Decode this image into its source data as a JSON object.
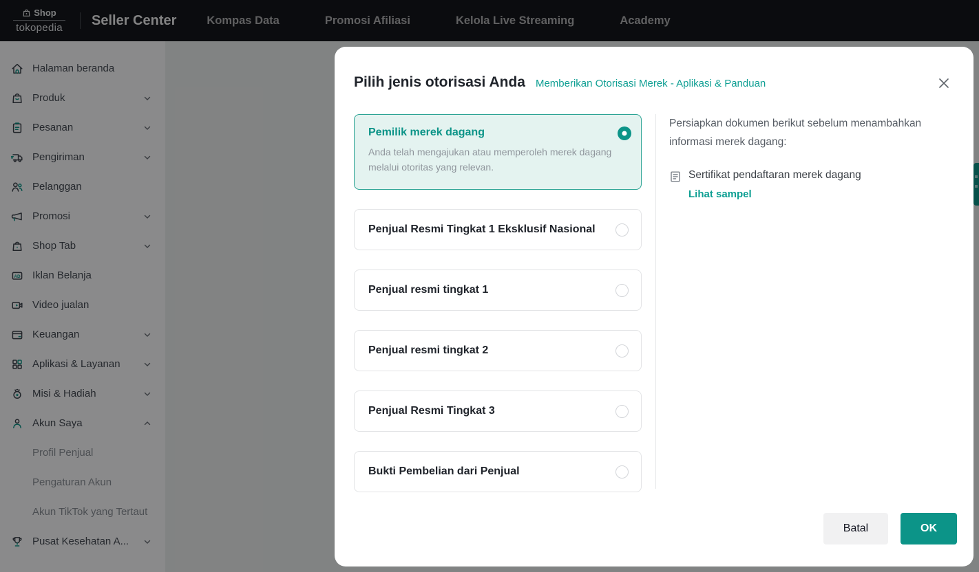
{
  "topbar": {
    "logo": {
      "shop_label": "Shop",
      "brand": "tokopedia"
    },
    "title": "Seller Center",
    "nav": [
      {
        "label": "Kompas Data"
      },
      {
        "label": "Promosi Afiliasi"
      },
      {
        "label": "Kelola Live Streaming"
      },
      {
        "label": "Academy"
      }
    ]
  },
  "sidebar": {
    "items": [
      {
        "label": "Halaman beranda",
        "icon": "home-icon",
        "chevron": "none"
      },
      {
        "label": "Produk",
        "icon": "product-bag-icon",
        "chevron": "down"
      },
      {
        "label": "Pesanan",
        "icon": "clipboard-icon",
        "chevron": "down"
      },
      {
        "label": "Pengiriman",
        "icon": "truck-icon",
        "chevron": "down"
      },
      {
        "label": "Pelanggan",
        "icon": "people-icon",
        "chevron": "none"
      },
      {
        "label": "Promosi",
        "icon": "megaphone-icon",
        "chevron": "down"
      },
      {
        "label": "Shop Tab",
        "icon": "shop-bag-icon",
        "chevron": "down"
      },
      {
        "label": "Iklan Belanja",
        "icon": "ad-icon",
        "chevron": "none"
      },
      {
        "label": "Video jualan",
        "icon": "video-icon",
        "chevron": "none"
      },
      {
        "label": "Keuangan",
        "icon": "card-icon",
        "chevron": "down"
      },
      {
        "label": "Aplikasi & Layanan",
        "icon": "apps-grid-icon",
        "chevron": "down"
      },
      {
        "label": "Misi & Hadiah",
        "icon": "medal-icon",
        "chevron": "down"
      },
      {
        "label": "Akun Saya",
        "icon": "user-icon",
        "chevron": "up"
      },
      {
        "label": "Pusat Kesehatan A...",
        "icon": "trophy-icon",
        "chevron": "down"
      }
    ],
    "akun_saya_children": [
      {
        "label": "Profil Penjual"
      },
      {
        "label": "Pengaturan Akun"
      },
      {
        "label": "Akun TikTok yang Tertaut"
      }
    ],
    "ad_icon_text": "AD"
  },
  "modal": {
    "title": "Pilih jenis otorisasi Anda",
    "help_link": "Memberikan Otorisasi Merek - Aplikasi & Panduan",
    "options": [
      {
        "label": "Pemilik merek dagang",
        "description": "Anda telah mengajukan atau memperoleh merek dagang melalui otoritas yang relevan.",
        "selected": true
      },
      {
        "label": "Penjual Resmi Tingkat 1 Eksklusif Nasional",
        "selected": false
      },
      {
        "label": "Penjual resmi tingkat 1",
        "selected": false
      },
      {
        "label": "Penjual resmi tingkat 2",
        "selected": false
      },
      {
        "label": "Penjual Resmi Tingkat 3",
        "selected": false
      },
      {
        "label": "Bukti Pembelian dari Penjual",
        "selected": false
      }
    ],
    "docs_panel": {
      "intro": "Persiapkan dokumen berikut sebelum menambahkan informasi merek dagang:",
      "documents": [
        {
          "name": "Sertifikat pendaftaran merek dagang",
          "sample_link": "Lihat sampel"
        }
      ]
    },
    "footer": {
      "cancel_label": "Batal",
      "ok_label": "OK"
    }
  },
  "colors": {
    "accent": "#0c9488",
    "link": "#0e9f93",
    "selected_card_bg": "#e4f3f0",
    "selected_card_border": "#2ba394",
    "topbar_bg": "#15171c"
  }
}
